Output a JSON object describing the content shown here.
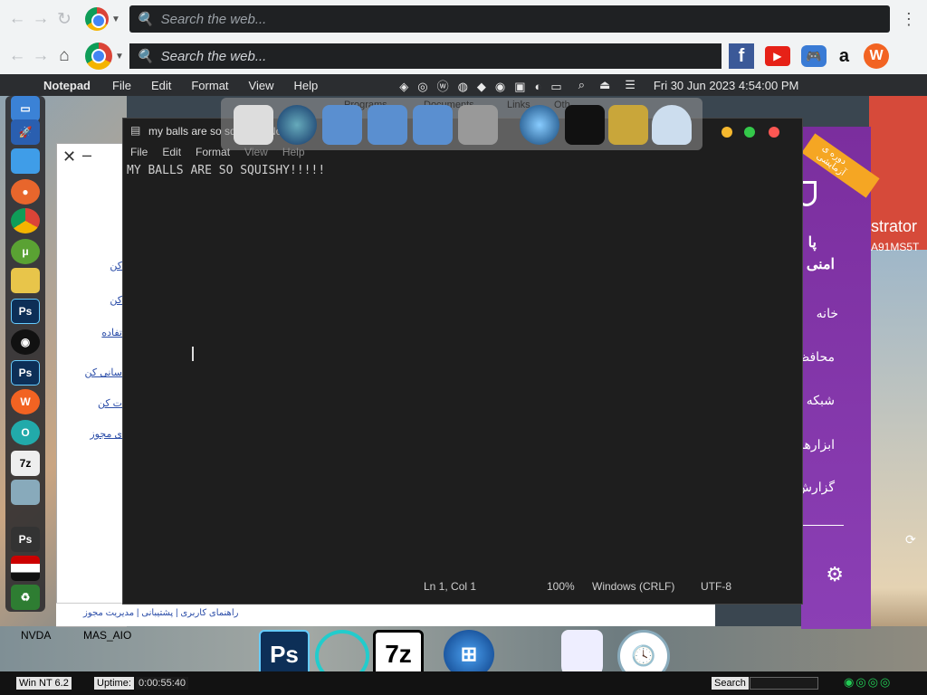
{
  "browser": {
    "search_placeholder_1": "Search the web...",
    "search_placeholder_2": "Search the web...",
    "icons": [
      "back-icon",
      "forward-icon",
      "refresh-icon",
      "home-icon",
      "chrome-icon",
      "facebook-icon",
      "youtube-icon",
      "games-icon",
      "amazon-icon",
      "w-icon"
    ]
  },
  "menubar": {
    "app_name": "Notepad",
    "menus": [
      "File",
      "Edit",
      "Format",
      "View",
      "Help"
    ],
    "datetime": "Fri 30 Jun 2023  4:54:00 PM"
  },
  "shelf": {
    "labels": [
      "Programs",
      "Documents",
      "Links",
      "Oth"
    ]
  },
  "notepad": {
    "tab_title": "my balls are so squish",
    "tab_suffix": "No",
    "menus": [
      "File",
      "Edit",
      "Format",
      "View",
      "Help"
    ],
    "content": "MY BALLS ARE SO SQUISHY!!!!!",
    "status": {
      "position": "Ln 1, Col 1",
      "zoom": "100%",
      "line_ending": "Windows (CRLF)",
      "encoding": "UTF-8"
    }
  },
  "right_panel": {
    "ribbon": "دوره ی آزمایشی",
    "title_line1": "پا",
    "title_line2": "امنی",
    "admin": "strator",
    "machine": "A91MS5T",
    "items": [
      "خانه",
      "محافظ",
      "شبکه",
      "ابزارها",
      "گزارش"
    ]
  },
  "left_panel": {
    "links": [
      "کن",
      "کن",
      "تفاده",
      "سانی کن",
      "ت کن",
      "ی مجوز"
    ],
    "footer": "راهنمای کاربری | پشتیبانی | مدیریت مجوز"
  },
  "desktop": {
    "labels": [
      "NVDA",
      "MAS_AIO"
    ]
  },
  "taskbar": {
    "os": "Win NT 6.2",
    "uptime_label": "Uptime:",
    "uptime_value": "0:00:55:40",
    "search_label": "Search"
  },
  "colors": {
    "menubar_bg": "#2b2d30",
    "notepad_bg": "#1e1e1e",
    "panel_purple": "#7b2e9e",
    "ribbon_orange": "#f5a623"
  }
}
